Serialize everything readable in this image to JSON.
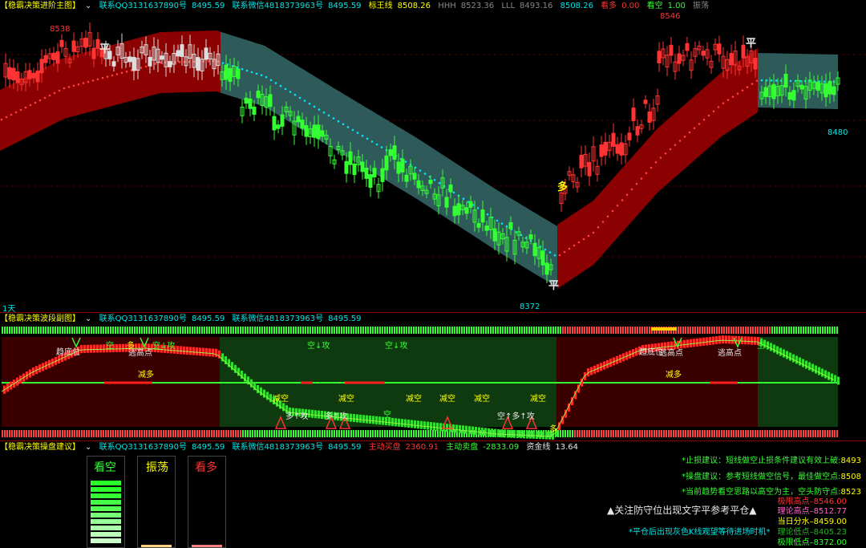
{
  "main": {
    "title": "【稳霸决策进阶主图】",
    "qq": "联系QQ3131637890号",
    "qq_val": "8495.59",
    "wx": "联系微信4818373963号",
    "wx_val": "8495.59",
    "biaowang_label": "标王线",
    "biaowang_val": "8508.26",
    "hhh": "HHH",
    "hhh_val": "8523.36",
    "lll": "LLL",
    "lll_val": "8493.16",
    "lll_val2": "8508.26",
    "kanduo": "看多",
    "kanduo_val": "0.00",
    "kankong": "看空",
    "kankong_val": "1.00",
    "zhendang": "振荡",
    "high_label": "8546",
    "high_left": "8538",
    "low_label": "8372",
    "last_label": "8480",
    "period": "1天",
    "ping1": "平",
    "ping2": "平",
    "ping3": "平",
    "duo": "多"
  },
  "wave": {
    "title": "【稳霸决策波段副图】",
    "qq": "联系QQ3131637890号",
    "qq_val": "8495.59",
    "wx": "联系微信4818373963号",
    "wx_val": "8495.59",
    "annotations": {
      "a1": "趋底位",
      "a2": "逃高点",
      "a3": "空",
      "a4": "多",
      "a5": "空↓攻",
      "a6": "空↓攻",
      "a7": "空↓攻",
      "a8": "减多",
      "a9": "减空",
      "a10": "减空",
      "a11": "减空",
      "a12": "减空",
      "a13": "减空",
      "a14": "减空",
      "a15": "多↑攻",
      "a16": "多↑攻",
      "a17": "空",
      "a18": "空↑多↑攻",
      "a19": "多",
      "a20": "趋底位",
      "a21": "逃高点",
      "a22": "逃高点",
      "a23": "减多",
      "a24": "空"
    }
  },
  "ops": {
    "title": "【稳霸决策操盘建议】",
    "qq": "联系QQ3131637890号",
    "qq_val": "8495.59",
    "wx": "联系微信4818373963号",
    "wx_val": "8495.59",
    "buy_label": "主动买盘",
    "buy_val": "2360.91",
    "sell_label": "主动卖盘",
    "sell_val": "-2833.09",
    "fund_label": "资金线",
    "fund_val": "13.64",
    "meter_kankong": "看空",
    "meter_zhendang": "振荡",
    "meter_kanduo": "看多",
    "advice1": "*止损建议：短线做空止损条件建议有效上破:",
    "advice1_val": "8493",
    "advice2": "*操盘建议：参考短线做空信号，最佳做空点:",
    "advice2_val": "8508",
    "advice3": "*当前趋势看空思路以高空为主，空头防守点:",
    "advice3_val": "8523",
    "notice": "▲关注防守位出现文字平参考平仓▲",
    "notice2": "*平仓后出现灰色K线观望等待进场时机*",
    "levels": [
      {
        "label": "极限高点",
        "val": "8546.00"
      },
      {
        "label": "理论高点",
        "val": "8512.77"
      },
      {
        "label": "当日分水",
        "val": "8459.00"
      },
      {
        "label": "理论低点",
        "val": "8405.23"
      },
      {
        "label": "极限低点",
        "val": "8372.00"
      }
    ]
  }
}
